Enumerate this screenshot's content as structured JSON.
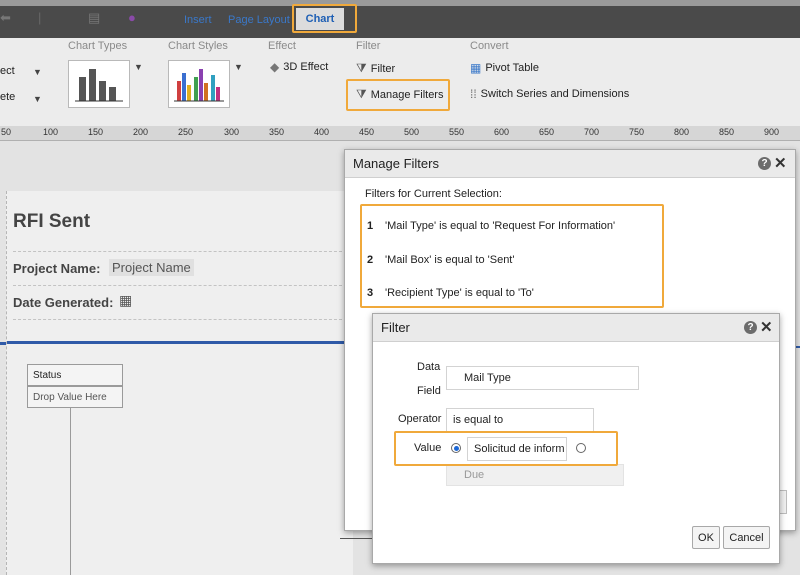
{
  "tabs": {
    "insert": "Insert",
    "page_layout": "Page Layout",
    "chart": "Chart"
  },
  "ribbon": {
    "groups": {
      "chart_types": "Chart Types",
      "chart_styles": "Chart Styles",
      "effect": "Effect",
      "filter": "Filter",
      "convert": "Convert"
    },
    "left_selects": [
      "ect",
      "ete"
    ],
    "effect_3d": "3D Effect",
    "filter_btn": "Filter",
    "manage_filters": "Manage Filters",
    "pivot_table": "Pivot Table",
    "switch_series": "Switch Series and Dimensions"
  },
  "ruler": [
    "50",
    "100",
    "150",
    "200",
    "250",
    "300",
    "350",
    "400",
    "450",
    "500",
    "550",
    "600",
    "650",
    "700",
    "750",
    "800",
    "850",
    "900"
  ],
  "report": {
    "title": "RFI Sent",
    "project_label": "Project Name:",
    "project_value": "Project Name",
    "date_label": "Date Generated:",
    "status_header": "Status",
    "drop_value": "Drop Value Here"
  },
  "manage_filters": {
    "title": "Manage Filters",
    "subtitle": "Filters for Current Selection:",
    "filters": [
      {
        "num": "1",
        "text": "'Mail Type' is equal to 'Request For Information'"
      },
      {
        "num": "2",
        "text": "'Mail Box' is equal to 'Sent'"
      },
      {
        "num": "3",
        "text": "'Recipient Type' is equal to 'To'"
      }
    ]
  },
  "filter_dialog": {
    "title": "Filter",
    "data_label": "Data",
    "field_label": "Field",
    "data_field_value": "Mail Type",
    "operator_label": "Operator",
    "operator_value": "is equal to",
    "value_label": "Value",
    "value_text": "Solicitud de inform",
    "due_text": "Due",
    "ok": "OK",
    "cancel": "Cancel"
  },
  "colors": {
    "highlight": "#f0a93b",
    "tab_text": "#3a78c9",
    "report_line": "#2f5aa8"
  }
}
